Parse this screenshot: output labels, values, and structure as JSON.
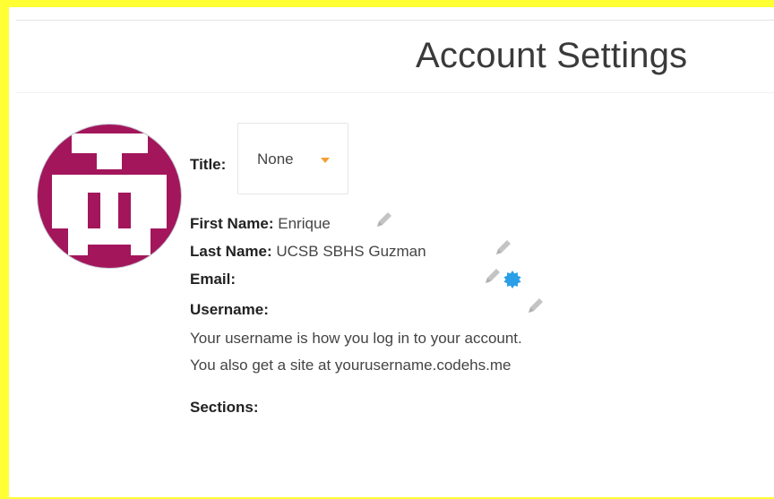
{
  "page": {
    "title": "Account Settings"
  },
  "profile": {
    "title_label": "Title:",
    "title_value": "None",
    "first_name_label": "First Name:",
    "first_name_value": "Enrique",
    "last_name_label": "Last Name:",
    "last_name_value": "UCSB SBHS Guzman",
    "email_label": "Email:",
    "email_value": "",
    "username_label": "Username:",
    "username_value": "",
    "username_help_line1": "Your username is how you log in to your account.",
    "username_help_line2": "You also get a site at yourusername.codehs.me",
    "sections_label": "Sections:"
  },
  "icons": {
    "edit": "pencil-icon",
    "verify": "blue-seal-icon",
    "dropdown": "caret-down-icon",
    "avatar": "pixel-avatar"
  },
  "colors": {
    "avatar_bg": "#a3165c",
    "avatar_ring": "#c9cfd8",
    "caret": "#f0a132",
    "seal": "#2a9fe8",
    "pencil": "#c4c4c4",
    "frame": "#ffff33"
  }
}
